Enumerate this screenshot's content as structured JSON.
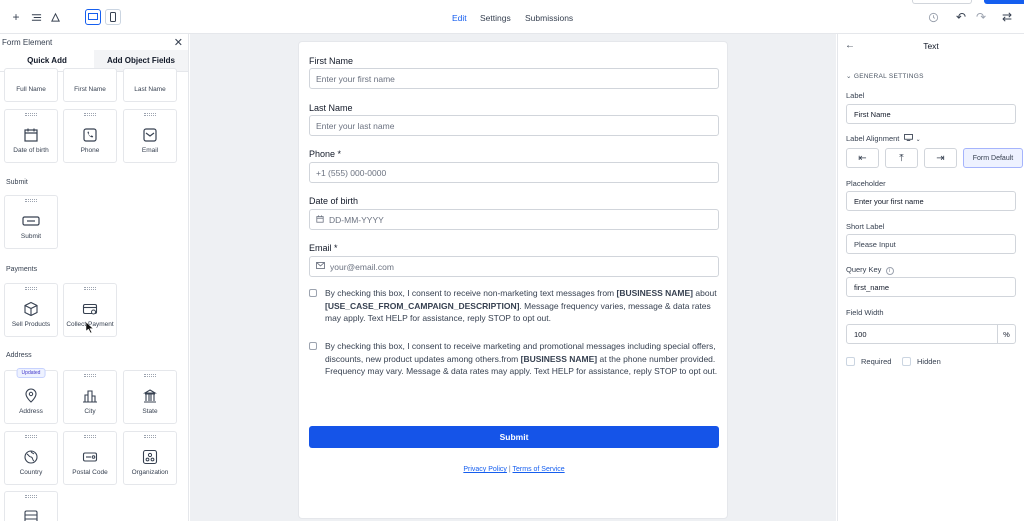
{
  "topbar": {
    "tabs": [
      "Edit",
      "Settings",
      "Submissions"
    ],
    "active_tab": "Edit"
  },
  "left_panel": {
    "title": "Form Element",
    "tabs": [
      "Quick Add",
      "Add Object Fields"
    ],
    "top_cards": [
      "Full Name",
      "First Name",
      "Last Name"
    ],
    "row2_cards": [
      "Date of birth",
      "Phone",
      "Email"
    ],
    "sections": {
      "submit": "Submit",
      "payments": "Payments",
      "address": "Address"
    },
    "submit_cards": [
      "Submit"
    ],
    "payment_cards": [
      "Sell Products",
      "Collect Payment"
    ],
    "address_cards_row1": [
      "Address",
      "City",
      "State"
    ],
    "address_cards_row2": [
      "Country",
      "Postal Code",
      "Organization"
    ],
    "updated_badge": "Updated"
  },
  "form": {
    "first_name_label": "First Name",
    "first_name_placeholder": "Enter your first name",
    "last_name_label": "Last Name",
    "last_name_placeholder": "Enter your last name",
    "phone_label": "Phone *",
    "phone_placeholder": "+1 (555) 000-0000",
    "dob_label": "Date of birth",
    "dob_placeholder": "DD-MM-YYYY",
    "email_label": "Email *",
    "email_placeholder": "your@email.com",
    "consent1_a": "By checking this box, I consent to receive non-marketing text messages from ",
    "consent1_b": "[BUSINESS NAME]",
    "consent1_c": " about ",
    "consent1_d": "[USE_CASE_FROM_CAMPAIGN_DESCRIPTION]",
    "consent1_e": ". Message frequency varies, message & data rates may apply. Text HELP for assistance, reply STOP to opt out.",
    "consent2_a": "By checking this box, I consent to receive marketing and promotional messages including special offers, discounts, new product updates among others.from ",
    "consent2_b": "[BUSINESS NAME]",
    "consent2_c": " at the phone number provided. Frequency may vary. Message & data rates may apply. Text HELP for assistance, reply STOP to opt out.",
    "submit_label": "Submit",
    "privacy_link": "Privacy Policy",
    "separator": " | ",
    "terms_link": "Terms of Service"
  },
  "right_panel": {
    "title": "Text",
    "section": "GENERAL SETTINGS",
    "label_label": "Label",
    "label_value": "First Name",
    "alignment_label": "Label Alignment",
    "alignment_selected": "Form Default",
    "placeholder_label": "Placeholder",
    "placeholder_value": "Enter your first name",
    "short_label_label": "Short Label",
    "short_label_value": "Please Input",
    "query_key_label": "Query Key",
    "query_key_value": "first_name",
    "field_width_label": "Field Width",
    "field_width_value": "100",
    "field_width_unit": "%",
    "required_label": "Required",
    "hidden_label": "Hidden"
  },
  "colors": {
    "accent": "#155eef",
    "submit_bg": "#1554e8",
    "canvas_bg": "#eef0f3"
  }
}
